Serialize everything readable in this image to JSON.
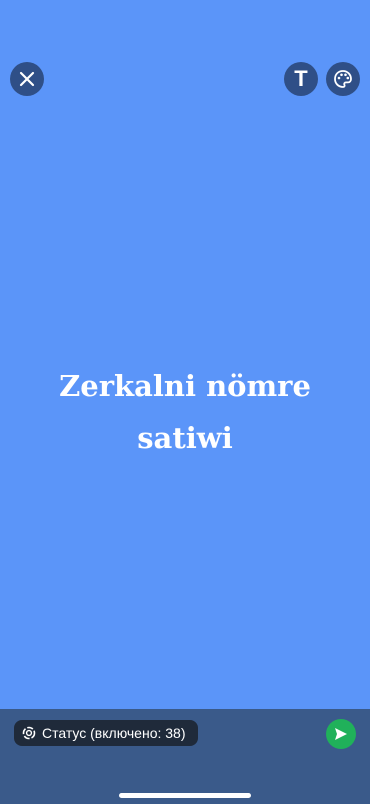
{
  "colors": {
    "canvas_background": "#5b95f9",
    "button_background": "#2f4f87",
    "bottom_bar": "#3a5a8a",
    "pill_background": "#1f2a3a",
    "send_button": "#20b15a",
    "text": "#ffffff"
  },
  "toolbar": {
    "close_icon": "close-icon",
    "text_button_glyph": "T",
    "text_icon": "text-icon",
    "palette_icon": "palette-icon"
  },
  "status": {
    "line1": "Zerkalni nömre",
    "line2": "satiwi"
  },
  "composer": {
    "privacy_label": "Статус (включено: 38)",
    "privacy_icon": "status-ring-icon",
    "send_icon": "send-icon"
  }
}
